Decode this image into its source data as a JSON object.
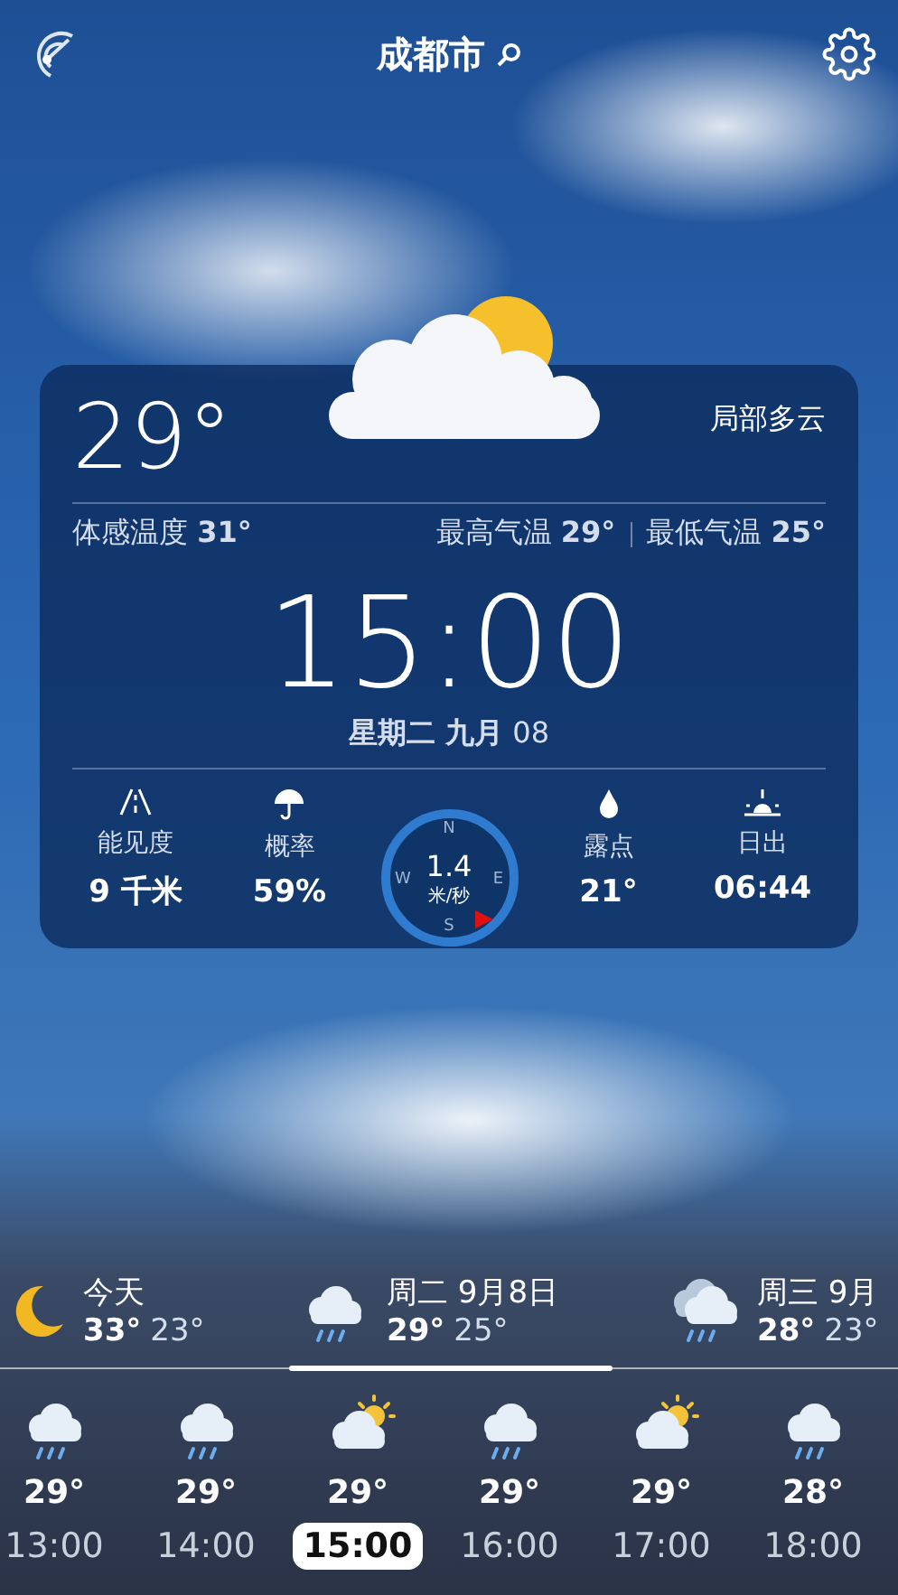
{
  "header": {
    "city": "成都市"
  },
  "current": {
    "temperature": "29°",
    "condition": "局部多云",
    "feels_like": "体感温度 **31°**",
    "high": "最高气温 **29°**",
    "low": "最低气温 **25°**",
    "time": "15:00",
    "date": "**星期二 九月** 08"
  },
  "stats": [
    {
      "kind": "visibility",
      "label": "能见度",
      "value": "9 千米"
    },
    {
      "kind": "umbrella",
      "label": "概率",
      "value": "59%"
    },
    {
      "kind": "wind",
      "value": "1.4",
      "unit": "米/秒",
      "directions": [
        "N",
        "E",
        "S",
        "W"
      ]
    },
    {
      "kind": "drop",
      "label": "露点",
      "value": "21°"
    },
    {
      "kind": "sunrise",
      "label": "日出",
      "value": "06:44"
    }
  ],
  "days": [
    {
      "kind": "moon",
      "name": "今天",
      "high": "33°",
      "low": "23°",
      "selected": false
    },
    {
      "kind": "rain",
      "name": "周二 9月8日",
      "high": "29°",
      "low": "25°",
      "selected": true
    },
    {
      "kind": "cloud-rain",
      "name": "周三 9月",
      "high": "28°",
      "low": "23°",
      "selected": false
    }
  ],
  "hours": [
    {
      "kind": "rain",
      "temp": "29°",
      "time": "13:00",
      "selected": false
    },
    {
      "kind": "rain",
      "temp": "29°",
      "time": "14:00",
      "selected": false
    },
    {
      "kind": "sun-cloud",
      "temp": "29°",
      "time": "15:00",
      "selected": true
    },
    {
      "kind": "rain",
      "temp": "29°",
      "time": "16:00",
      "selected": false
    },
    {
      "kind": "sun-cloud",
      "temp": "29°",
      "time": "17:00",
      "selected": false
    },
    {
      "kind": "rain",
      "temp": "28°",
      "time": "18:00",
      "selected": false
    }
  ]
}
